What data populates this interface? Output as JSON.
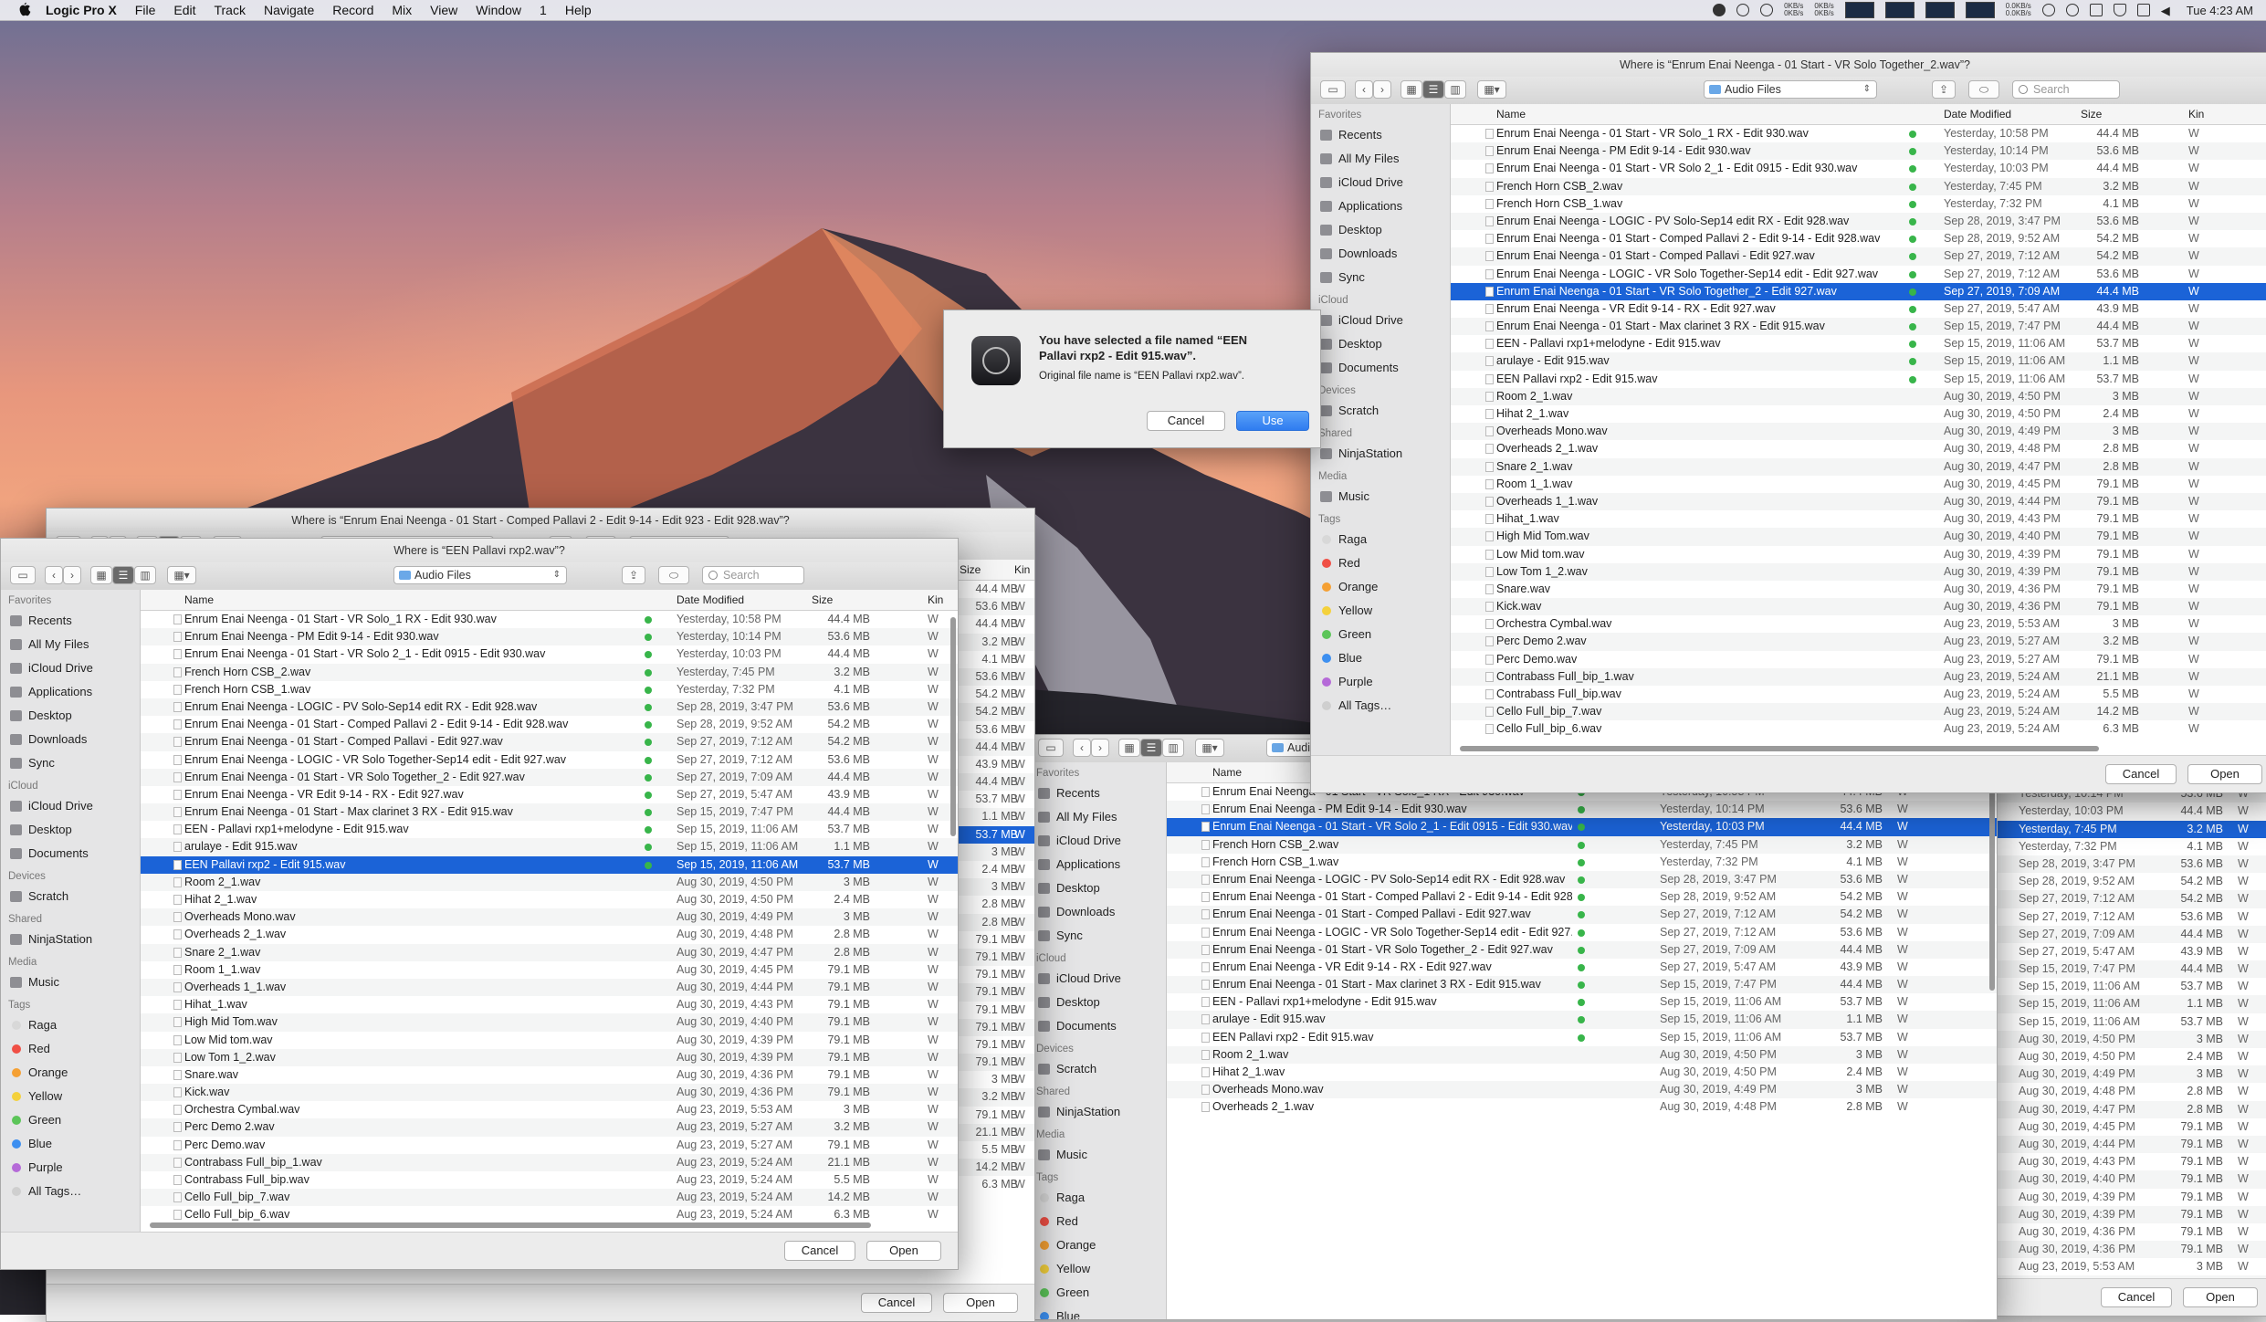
{
  "menubar": {
    "app": "Logic Pro X",
    "items": [
      "File",
      "Edit",
      "Track",
      "Navigate",
      "Record",
      "Mix",
      "View",
      "Window",
      "1",
      "Help"
    ],
    "net_up": "0KB/s",
    "net_down": "0KB/s",
    "net2_up": "0KB/s",
    "net2_down": "0KB/s",
    "disk_up": "0.0KB/s",
    "disk_down": "0.0KB/s",
    "clock": "Tue 4:23 AM"
  },
  "common": {
    "location": "Audio Files",
    "search_placeholder": "Search",
    "col_name": "Name",
    "col_date": "Date Modified",
    "col_size": "Size",
    "col_kind": "Kin",
    "kind_val": "W",
    "cancel": "Cancel",
    "open": "Open",
    "sidebar": {
      "favorites": "Favorites",
      "fav_items": [
        "Recents",
        "All My Files",
        "iCloud Drive",
        "Applications",
        "Desktop",
        "Downloads",
        "Sync"
      ],
      "icloud": "iCloud",
      "icloud_items": [
        "iCloud Drive",
        "Desktop",
        "Documents"
      ],
      "devices": "Devices",
      "device_items": [
        "Scratch"
      ],
      "shared": "Shared",
      "shared_items": [
        "NinjaStation"
      ],
      "media": "Media",
      "media_items": [
        "Music"
      ],
      "tags": "Tags",
      "tag_items": [
        {
          "name": "Raga",
          "color": "#d8d8d8"
        },
        {
          "name": "Red",
          "color": "#f04f45"
        },
        {
          "name": "Orange",
          "color": "#f5a033"
        },
        {
          "name": "Yellow",
          "color": "#f4d13c"
        },
        {
          "name": "Green",
          "color": "#5cc559"
        },
        {
          "name": "Blue",
          "color": "#3d8ff0"
        },
        {
          "name": "Purple",
          "color": "#b56ad8"
        },
        {
          "name": "All Tags…",
          "color": "#cfcfcf"
        }
      ]
    }
  },
  "files": [
    {
      "name": "Enrum Enai Neenga - 01 Start - VR Solo_1 RX - Edit 930.wav",
      "date": "Yesterday, 10:58 PM",
      "size": "44.4 MB",
      "tag": true
    },
    {
      "name": "Enrum Enai Neenga - PM Edit 9-14 - Edit 930.wav",
      "date": "Yesterday, 10:14 PM",
      "size": "53.6 MB",
      "tag": true
    },
    {
      "name": "Enrum Enai Neenga - 01 Start - VR Solo 2_1 - Edit 0915 - Edit 930.wav",
      "date": "Yesterday, 10:03 PM",
      "size": "44.4 MB",
      "tag": true
    },
    {
      "name": "French Horn CSB_2.wav",
      "date": "Yesterday, 7:45 PM",
      "size": "3.2 MB",
      "tag": true
    },
    {
      "name": "French Horn CSB_1.wav",
      "date": "Yesterday, 7:32 PM",
      "size": "4.1 MB",
      "tag": true
    },
    {
      "name": "Enrum Enai Neenga - LOGIC - PV Solo-Sep14 edit RX - Edit 928.wav",
      "date": "Sep 28, 2019, 3:47 PM",
      "size": "53.6 MB",
      "tag": true
    },
    {
      "name": "Enrum Enai Neenga - 01 Start - Comped Pallavi 2 - Edit 9-14 - Edit 928.wav",
      "date": "Sep 28, 2019, 9:52 AM",
      "size": "54.2 MB",
      "tag": true
    },
    {
      "name": "Enrum Enai Neenga - 01 Start - Comped Pallavi - Edit 927.wav",
      "date": "Sep 27, 2019, 7:12 AM",
      "size": "54.2 MB",
      "tag": true
    },
    {
      "name": "Enrum Enai Neenga - LOGIC - VR Solo Together-Sep14 edit - Edit 927.wav",
      "date": "Sep 27, 2019, 7:12 AM",
      "size": "53.6 MB",
      "tag": true
    },
    {
      "name": "Enrum Enai Neenga - 01 Start - VR Solo Together_2 - Edit 927.wav",
      "date": "Sep 27, 2019, 7:09 AM",
      "size": "44.4 MB",
      "tag": true
    },
    {
      "name": "Enrum Enai Neenga - VR Edit 9-14 - RX - Edit 927.wav",
      "date": "Sep 27, 2019, 5:47 AM",
      "size": "43.9 MB",
      "tag": true
    },
    {
      "name": "Enrum Enai Neenga - 01 Start - Max clarinet 3 RX - Edit 915.wav",
      "date": "Sep 15, 2019, 7:47 PM",
      "size": "44.4 MB",
      "tag": true
    },
    {
      "name": "EEN - Pallavi rxp1+melodyne - Edit 915.wav",
      "date": "Sep 15, 2019, 11:06 AM",
      "size": "53.7 MB",
      "tag": true
    },
    {
      "name": "arulaye - Edit 915.wav",
      "date": "Sep 15, 2019, 11:06 AM",
      "size": "1.1 MB",
      "tag": true
    },
    {
      "name": "EEN Pallavi rxp2 - Edit 915.wav",
      "date": "Sep 15, 2019, 11:06 AM",
      "size": "53.7 MB",
      "tag": true
    },
    {
      "name": "Room 2_1.wav",
      "date": "Aug 30, 2019, 4:50 PM",
      "size": "3 MB",
      "tag": false
    },
    {
      "name": "Hihat 2_1.wav",
      "date": "Aug 30, 2019, 4:50 PM",
      "size": "2.4 MB",
      "tag": false
    },
    {
      "name": "Overheads Mono.wav",
      "date": "Aug 30, 2019, 4:49 PM",
      "size": "3 MB",
      "tag": false
    },
    {
      "name": "Overheads 2_1.wav",
      "date": "Aug 30, 2019, 4:48 PM",
      "size": "2.8 MB",
      "tag": false
    },
    {
      "name": "Snare 2_1.wav",
      "date": "Aug 30, 2019, 4:47 PM",
      "size": "2.8 MB",
      "tag": false
    },
    {
      "name": "Room 1_1.wav",
      "date": "Aug 30, 2019, 4:45 PM",
      "size": "79.1 MB",
      "tag": false
    },
    {
      "name": "Overheads 1_1.wav",
      "date": "Aug 30, 2019, 4:44 PM",
      "size": "79.1 MB",
      "tag": false
    },
    {
      "name": "Hihat_1.wav",
      "date": "Aug 30, 2019, 4:43 PM",
      "size": "79.1 MB",
      "tag": false
    },
    {
      "name": "High Mid Tom.wav",
      "date": "Aug 30, 2019, 4:40 PM",
      "size": "79.1 MB",
      "tag": false
    },
    {
      "name": "Low Mid tom.wav",
      "date": "Aug 30, 2019, 4:39 PM",
      "size": "79.1 MB",
      "tag": false
    },
    {
      "name": "Low Tom 1_2.wav",
      "date": "Aug 30, 2019, 4:39 PM",
      "size": "79.1 MB",
      "tag": false
    },
    {
      "name": "Snare.wav",
      "date": "Aug 30, 2019, 4:36 PM",
      "size": "79.1 MB",
      "tag": false
    },
    {
      "name": "Kick.wav",
      "date": "Aug 30, 2019, 4:36 PM",
      "size": "79.1 MB",
      "tag": false
    },
    {
      "name": "Orchestra Cymbal.wav",
      "date": "Aug 23, 2019, 5:53 AM",
      "size": "3 MB",
      "tag": false
    },
    {
      "name": "Perc Demo 2.wav",
      "date": "Aug 23, 2019, 5:27 AM",
      "size": "3.2 MB",
      "tag": false
    },
    {
      "name": "Perc Demo.wav",
      "date": "Aug 23, 2019, 5:27 AM",
      "size": "79.1 MB",
      "tag": false
    },
    {
      "name": "Contrabass Full_bip_1.wav",
      "date": "Aug 23, 2019, 5:24 AM",
      "size": "21.1 MB",
      "tag": false
    },
    {
      "name": "Contrabass Full_bip.wav",
      "date": "Aug 23, 2019, 5:24 AM",
      "size": "5.5 MB",
      "tag": false
    },
    {
      "name": "Cello Full_bip_7.wav",
      "date": "Aug 23, 2019, 5:24 AM",
      "size": "14.2 MB",
      "tag": false
    },
    {
      "name": "Cello Full_bip_6.wav",
      "date": "Aug 23, 2019, 5:24 AM",
      "size": "6.3 MB",
      "tag": false
    }
  ],
  "win_right": {
    "title": "Where is “Enrum Enai Neenga - 01 Start - VR Solo Together_2.wav”?",
    "selected": 9
  },
  "win_left": {
    "title": "Where is “EEN Pallavi rxp2.wav”?",
    "selected": 14
  },
  "win_left_back": {
    "title": "Where is “Enrum Enai Neenga - 01 Start - Comped Pallavi 2 - Edit 9-14 - Edit 923 - Edit 928.wav”?"
  },
  "win_mid": {
    "selected": 2
  },
  "win_back_right": {
    "selected": 3
  },
  "alert": {
    "title": "You have selected a file named “EEN Pallavi rxp2 - Edit 915.wav”.",
    "subtitle": "Original file name is “EEN Pallavi rxp2.wav”.",
    "cancel": "Cancel",
    "use": "Use"
  }
}
